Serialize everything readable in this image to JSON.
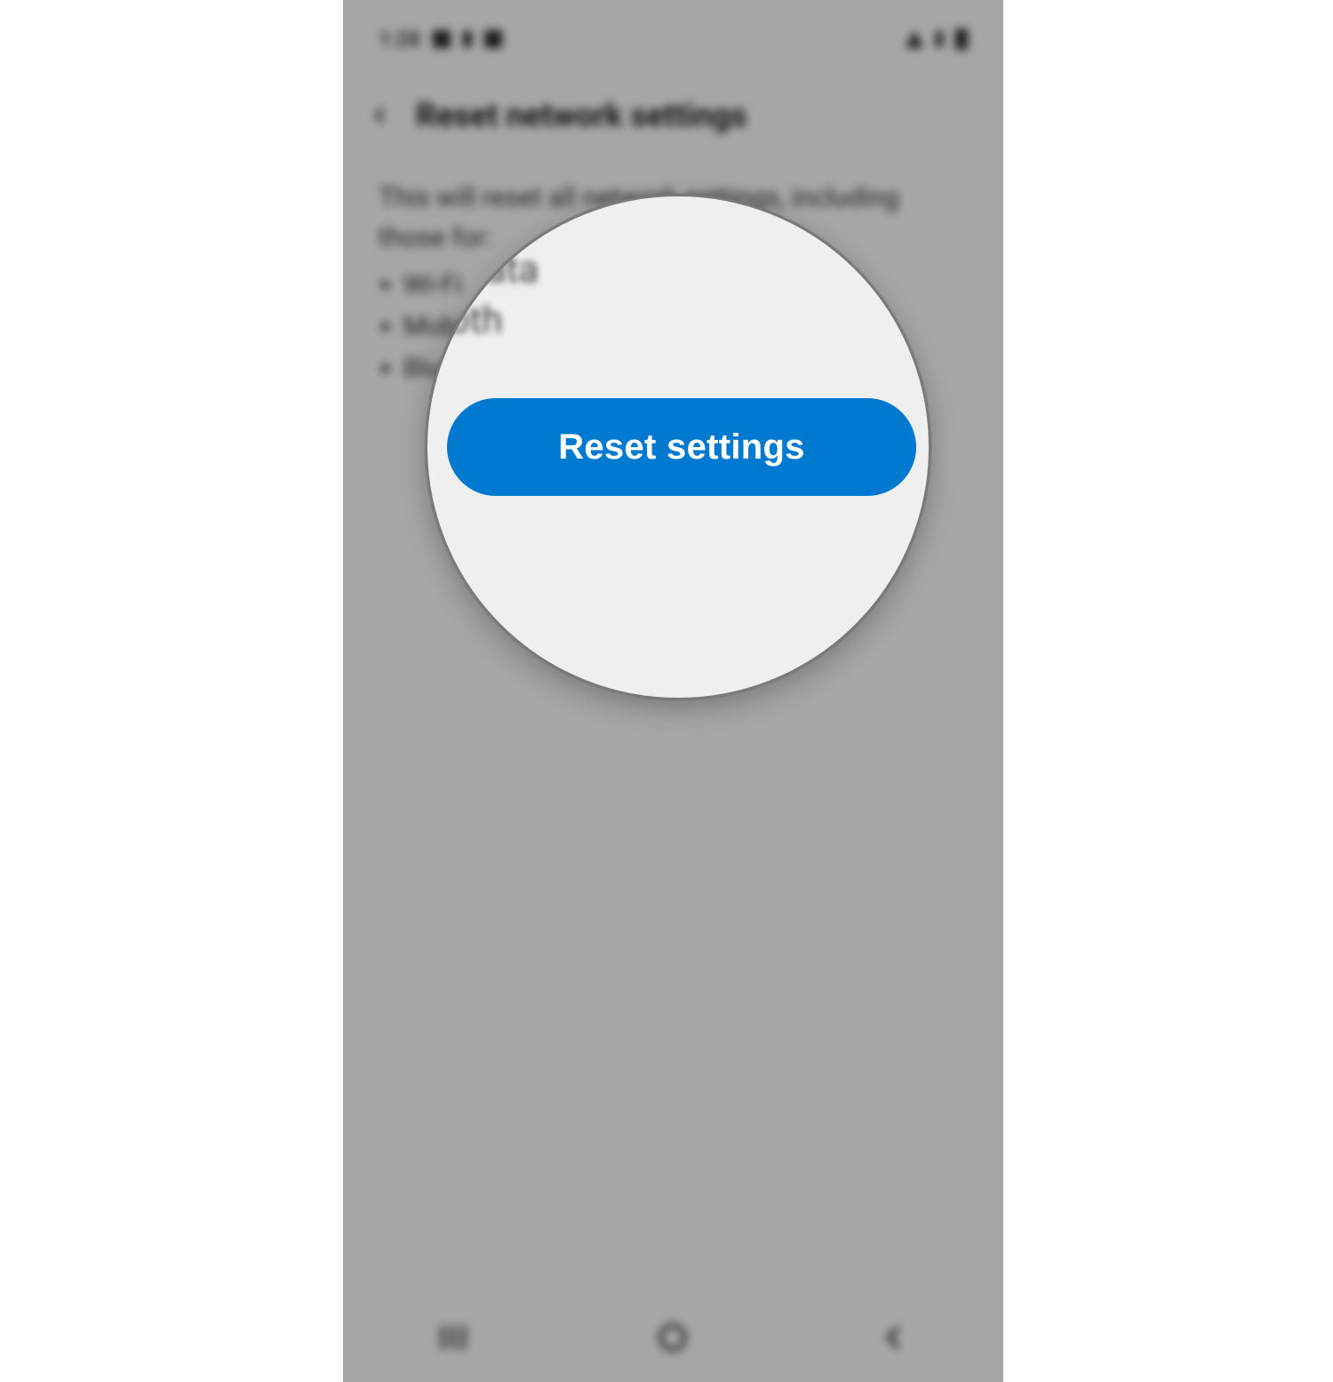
{
  "statusbar": {
    "time": "1:28"
  },
  "header": {
    "title": "Reset network settings"
  },
  "body": {
    "intro": "This will reset all network settings, including those for:",
    "items": [
      "Wi-Fi",
      "Mobile data",
      "Bluetooth"
    ]
  },
  "magnifier": {
    "fragment1": "• Mobile data",
    "fragment2": "• Bluetooth",
    "button_label": "Reset settings"
  },
  "colors": {
    "primary_button_bg": "#0079d1",
    "primary_button_text": "#ffffff",
    "magnifier_bg": "#efefef",
    "magnifier_border": "#7a7a7a",
    "dim_overlay": "rgba(0,0,0,0.34)"
  }
}
